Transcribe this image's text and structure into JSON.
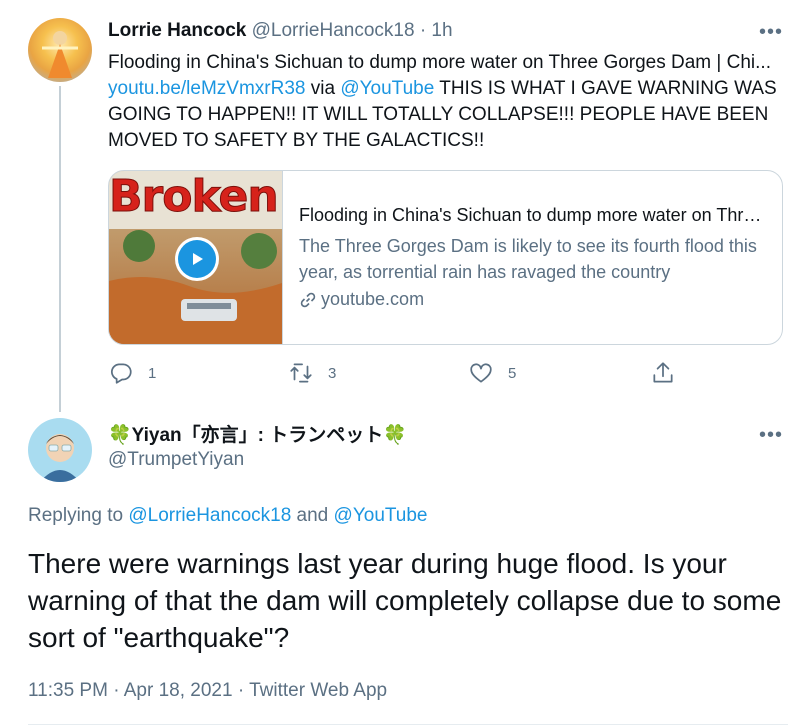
{
  "tweet1": {
    "name": "Lorrie Hancock",
    "handle": "@LorrieHancock18",
    "time": "· 1h",
    "text_start": "Flooding in China's Sichuan to dump more water on Three Gorges Dam | Chi... ",
    "link1": "youtu.be/leMzVmxrR38",
    "via": " via ",
    "link2": "@YouTube",
    "text_end": " THIS IS WHAT I GAVE WARNING WAS GOING TO HAPPEN!! IT WILL TOTALLY COLLAPSE!!! PEOPLE HAVE BEEN MOVED TO SAFETY BY THE GALACTICS!!",
    "card": {
      "thumb_text": "Broken Da",
      "title": "Flooding in China's Sichuan to dump more water on Three Gorges Dam",
      "description": "The Three Gorges Dam is likely to see its fourth flood this year, as torrential rain has ravaged the country",
      "domain": "youtube.com"
    },
    "actions": {
      "replies": "1",
      "retweets": "3",
      "likes": "5"
    }
  },
  "tweet2": {
    "name": "🍀Yiyan「亦言」: トランペット🍀",
    "handle": "@TrumpetYiyan",
    "replying_prefix": "Replying to ",
    "replying_user1": "@LorrieHancock18",
    "replying_and": " and ",
    "replying_user2": "@YouTube",
    "text": "There were warnings last year during huge flood. Is your warning of that the dam will completely collapse due to some sort of \"earthquake\"?",
    "timestamp": "11:35 PM · Apr 18, 2021 · Twitter Web App"
  },
  "more_label": "•••",
  "colors": {
    "link": "#1b95e0",
    "muted": "#5b7083",
    "border": "#ccd6dd"
  },
  "icons": [
    "reply-icon",
    "retweet-icon",
    "like-icon",
    "share-icon",
    "play-icon",
    "link-icon",
    "more-icon"
  ]
}
